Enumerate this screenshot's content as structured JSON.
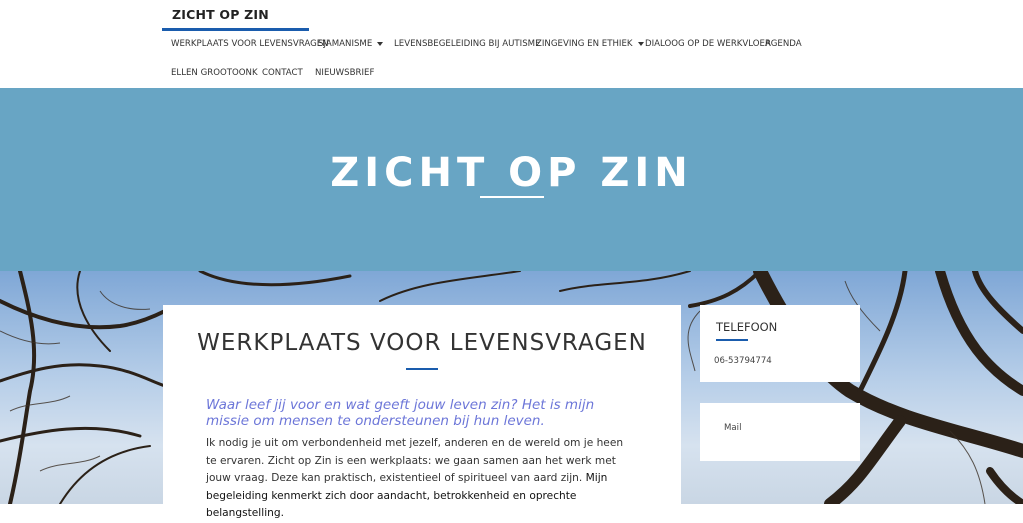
{
  "site": {
    "brand": "ZICHT OP ZIN",
    "accent": "#1a5cad",
    "hero_bg": "#68a5c4"
  },
  "nav": {
    "items": [
      {
        "label": "WERKPLAATS VOOR LEVENSVRAGEN"
      },
      {
        "label": "SJAMANISME"
      },
      {
        "label": "LEVENSBEGELEIDING BIJ AUTISME"
      },
      {
        "label": "ZINGEVING EN ETHIEK"
      },
      {
        "label": "DIALOOG OP DE WERKVLOER"
      },
      {
        "label": "AGENDA"
      },
      {
        "label": "ELLEN GROOTOONK"
      },
      {
        "label": "CONTACT"
      },
      {
        "label": "NIEUWSBRIEF"
      }
    ]
  },
  "hero": {
    "title": "ZICHT OP ZIN"
  },
  "main": {
    "title": "WERKPLAATS VOOR LEVENSVRAGEN",
    "lead": "Waar leef jij voor en wat geeft jouw leven zin?  Het is mijn missie om mensen te ondersteunen bij hun leven.",
    "body_1": "Ik nodig je uit om verbondenheid met jezelf, anderen en de wereld om je heen te ervaren. Zicht op Zin is een werkplaats: we gaan samen aan het werk met jouw vraag. Deze kan praktisch, existentieel of spiritueel van aard zijn. ",
    "body_2": "Mijn begeleiding kenmerkt zich door aandacht, betrokkenheid en oprechte belangstelling."
  },
  "sidebar": {
    "phone_title": "TELEFOON",
    "phone_value": "06-53794774",
    "mail_label": "Mail"
  }
}
